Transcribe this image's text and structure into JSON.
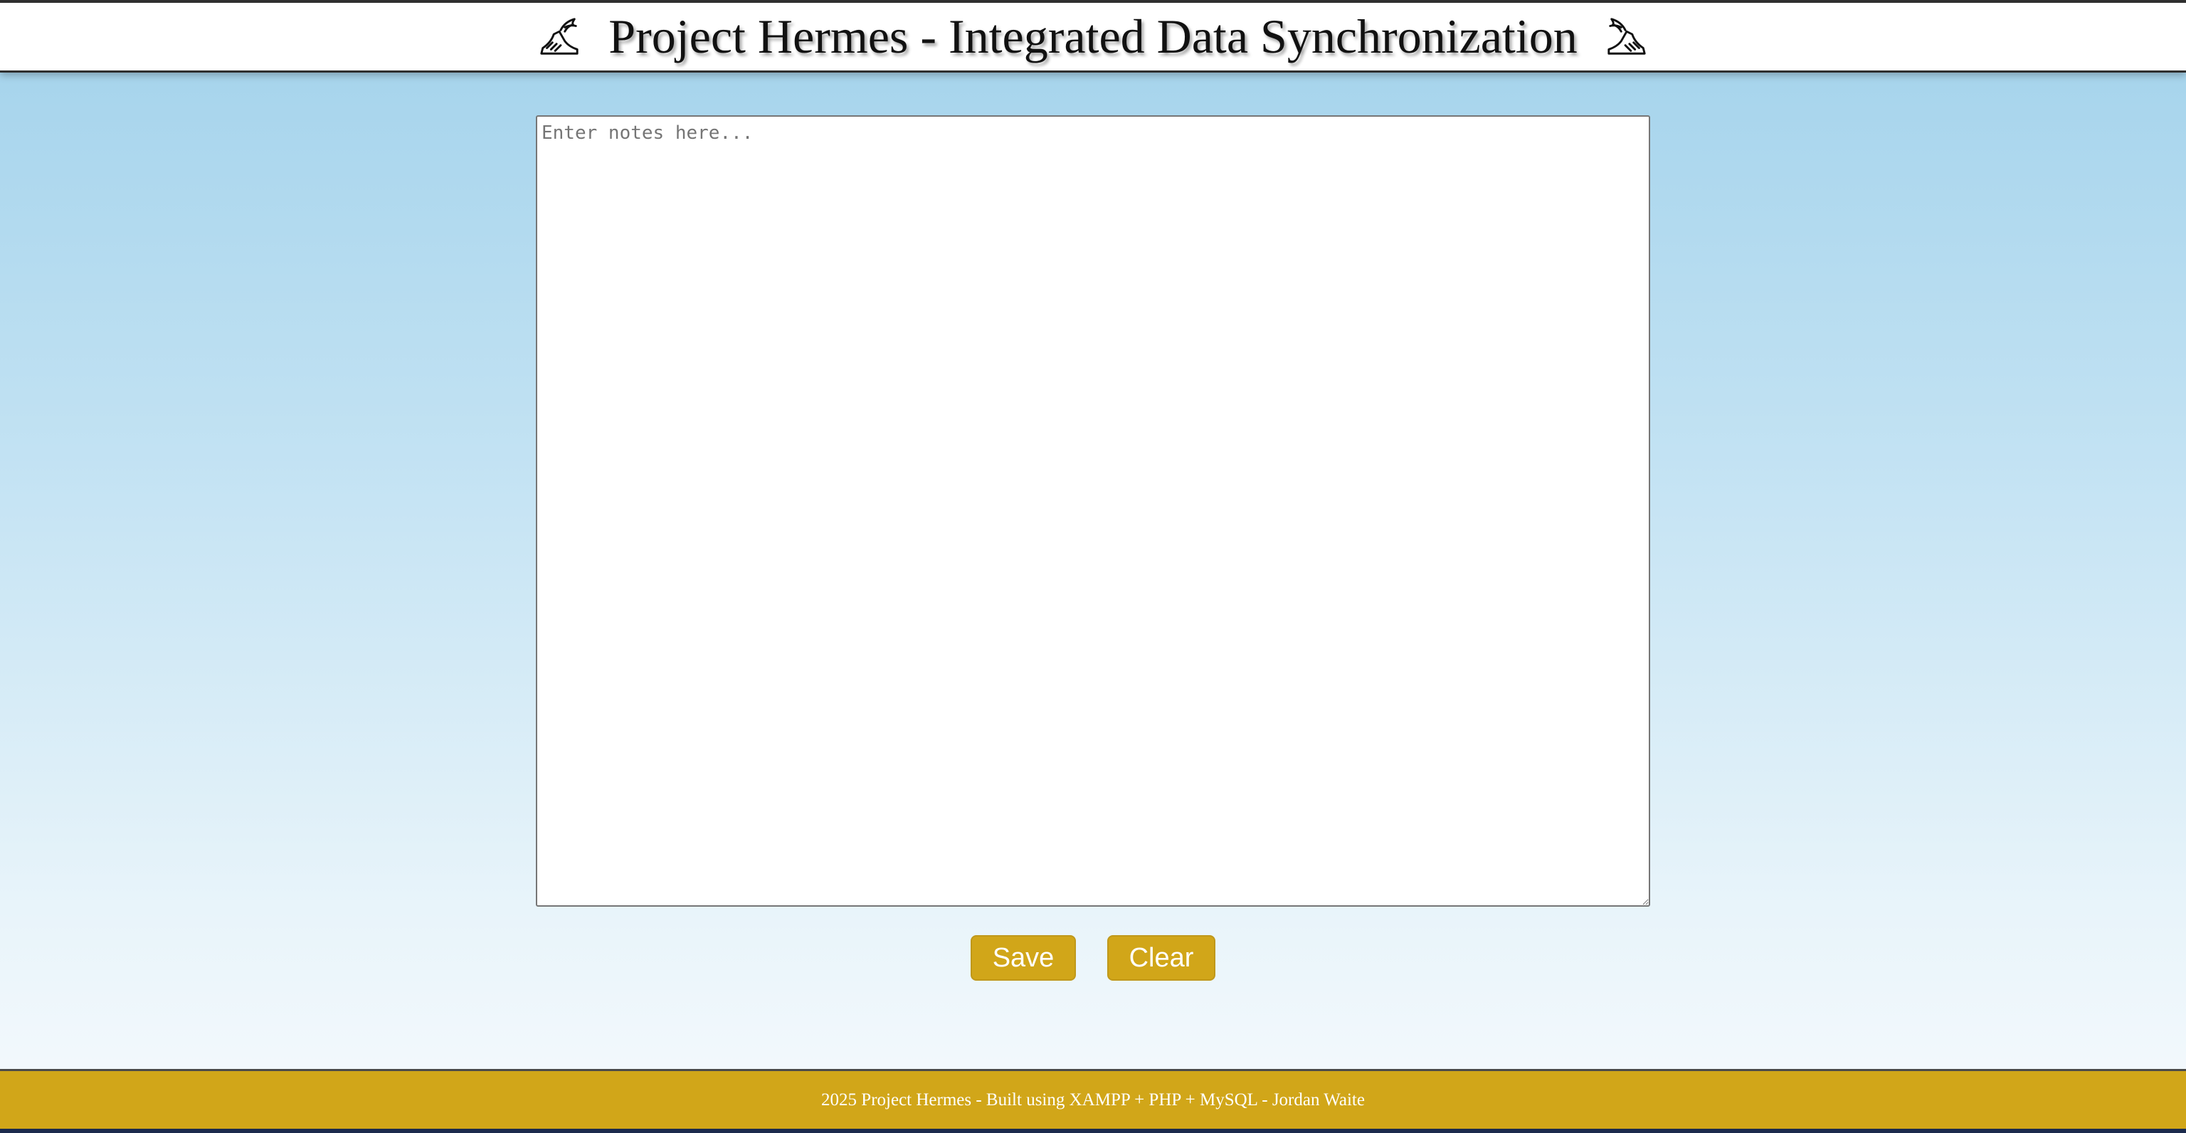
{
  "header": {
    "title": "Project Hermes - Integrated Data Synchronization",
    "left_icon": "winged-sandal-icon",
    "right_icon": "winged-sandal-icon"
  },
  "notes": {
    "value": "",
    "placeholder": "Enter notes here..."
  },
  "actions": {
    "save_label": "Save",
    "clear_label": "Clear",
    "button_color": "#d1a619"
  },
  "footer": {
    "text": "2025 Project Hermes - Built using XAMPP + PHP + MySQL - Jordan Waite",
    "background_color": "#d1a619"
  }
}
